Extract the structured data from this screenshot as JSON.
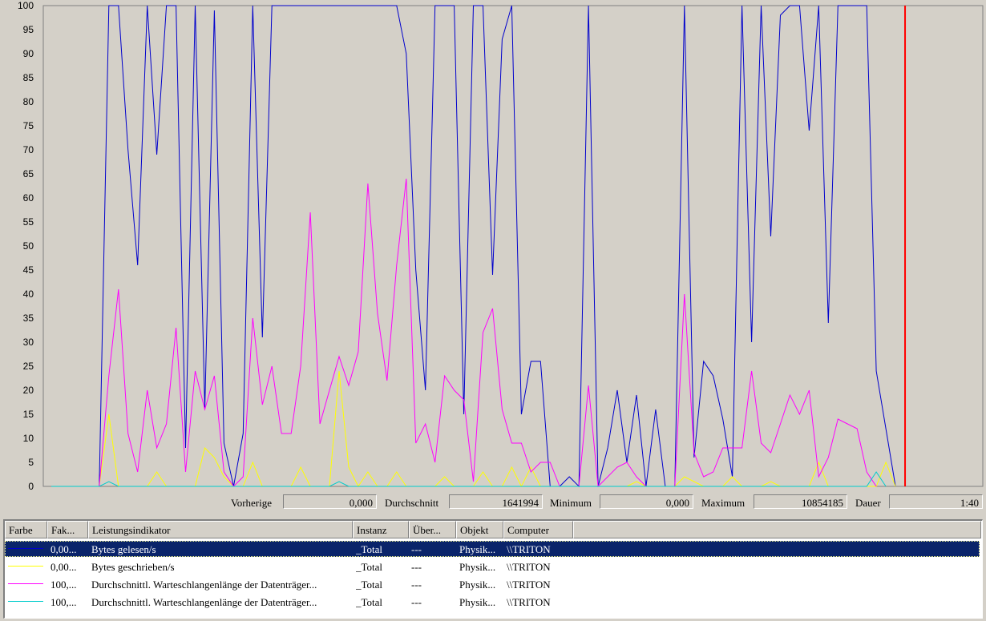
{
  "chart_data": {
    "type": "line",
    "ylim": [
      0,
      100
    ],
    "y_ticks": [
      "0",
      "5",
      "10",
      "15",
      "20",
      "25",
      "30",
      "35",
      "40",
      "45",
      "50",
      "55",
      "60",
      "65",
      "70",
      "75",
      "80",
      "85",
      "90",
      "95",
      "100"
    ],
    "x_count": 98,
    "current_marker_index": 89,
    "series": [
      {
        "color": "#0000cc",
        "values": [
          0,
          0,
          0,
          0,
          0,
          0,
          100,
          100,
          70,
          46,
          100,
          69,
          100,
          100,
          8,
          100,
          16,
          99,
          9,
          0,
          11,
          100,
          31,
          100,
          100,
          100,
          100,
          100,
          100,
          100,
          100,
          100,
          100,
          100,
          100,
          100,
          100,
          90,
          45,
          20,
          100,
          100,
          100,
          15,
          100,
          100,
          44,
          93,
          100,
          15,
          26,
          26,
          0,
          0,
          2,
          0,
          100,
          0,
          8,
          20,
          5,
          19,
          0,
          16,
          0,
          0,
          100,
          6,
          26,
          23,
          14,
          2,
          100,
          30,
          100,
          52,
          98,
          100,
          100,
          74,
          100,
          34,
          100,
          100,
          100,
          100,
          24,
          12,
          0
        ]
      },
      {
        "color": "#ffff00",
        "values": [
          0,
          0,
          0,
          0,
          0,
          0,
          15,
          0,
          0,
          0,
          0,
          3,
          0,
          0,
          0,
          0,
          8,
          6,
          2,
          0,
          0,
          5,
          0,
          0,
          0,
          0,
          4,
          0,
          0,
          0,
          24,
          4,
          0,
          3,
          0,
          0,
          3,
          0,
          0,
          0,
          0,
          2,
          0,
          0,
          0,
          3,
          0,
          0,
          4,
          0,
          4,
          0,
          0,
          0,
          0,
          0,
          0,
          0,
          0,
          0,
          0,
          1,
          0,
          0,
          0,
          0,
          2,
          1,
          0,
          0,
          0,
          2,
          0,
          0,
          0,
          1,
          0,
          0,
          0,
          0,
          5,
          0,
          0,
          0,
          0,
          0,
          0,
          5,
          0
        ]
      },
      {
        "color": "#ff00ff",
        "values": [
          0,
          0,
          0,
          0,
          0,
          0,
          23,
          41,
          11,
          3,
          20,
          8,
          13,
          33,
          3,
          24,
          16,
          23,
          3,
          0,
          2,
          35,
          17,
          25,
          11,
          11,
          25,
          57,
          13,
          20,
          27,
          21,
          28,
          63,
          36,
          22,
          46,
          64,
          9,
          13,
          5,
          23,
          20,
          18,
          1,
          32,
          37,
          16,
          9,
          9,
          3,
          5,
          5,
          0,
          0,
          0,
          21,
          0,
          2,
          4,
          5,
          2,
          0,
          0,
          0,
          0,
          40,
          7,
          2,
          3,
          8,
          8,
          8,
          24,
          9,
          7,
          13,
          19,
          15,
          20,
          2,
          6,
          14,
          13,
          12,
          3,
          0
        ]
      },
      {
        "color": "#00cccc",
        "values": [
          0,
          0,
          0,
          0,
          0,
          0,
          1,
          0,
          0,
          0,
          0,
          0,
          0,
          0,
          0,
          0,
          0,
          0,
          0,
          0,
          0,
          0,
          0,
          0,
          0,
          0,
          0,
          0,
          0,
          0,
          1,
          0,
          0,
          0,
          0,
          0,
          0,
          0,
          0,
          0,
          0,
          0,
          0,
          0,
          0,
          0,
          0,
          0,
          0,
          0,
          0,
          0,
          0,
          0,
          0,
          0,
          0,
          0,
          0,
          0,
          0,
          0,
          0,
          0,
          0,
          0,
          0,
          0,
          0,
          0,
          0,
          0,
          0,
          0,
          0,
          0,
          0,
          0,
          0,
          0,
          0,
          0,
          0,
          0,
          0,
          0,
          3,
          0
        ]
      }
    ]
  },
  "stats": {
    "prev_label": "Vorherige",
    "prev_value": "0,000",
    "avg_label": "Durchschnitt",
    "avg_value": "1641994",
    "min_label": "Minimum",
    "min_value": "0,000",
    "max_label": "Maximum",
    "max_value": "10854185",
    "dur_label": "Dauer",
    "dur_value": "1:40"
  },
  "columns": [
    "Farbe",
    "Fak...",
    "Leistungsindikator",
    "Instanz",
    "Über...",
    "Objekt",
    "Computer"
  ],
  "rows": [
    {
      "color": "#0000cc",
      "factor": "0,00...",
      "counter": "Bytes gelesen/s",
      "instance": "_Total",
      "parent": "---",
      "object": "Physik...",
      "computer": "\\\\TRITON"
    },
    {
      "color": "#ffff00",
      "factor": "0,00...",
      "counter": "Bytes geschrieben/s",
      "instance": "_Total",
      "parent": "---",
      "object": "Physik...",
      "computer": "\\\\TRITON"
    },
    {
      "color": "#ff00ff",
      "factor": "100,...",
      "counter": "Durchschnittl. Warteschlangenlänge der Datenträger...",
      "instance": "_Total",
      "parent": "---",
      "object": "Physik...",
      "computer": "\\\\TRITON"
    },
    {
      "color": "#00cccc",
      "factor": "100,...",
      "counter": "Durchschnittl. Warteschlangenlänge der Datenträger...",
      "instance": "_Total",
      "parent": "---",
      "object": "Physik...",
      "computer": "\\\\TRITON"
    }
  ],
  "colors": {
    "selection": "#0a246a",
    "marker": "#ff0000",
    "background": "#d4d0c8"
  }
}
